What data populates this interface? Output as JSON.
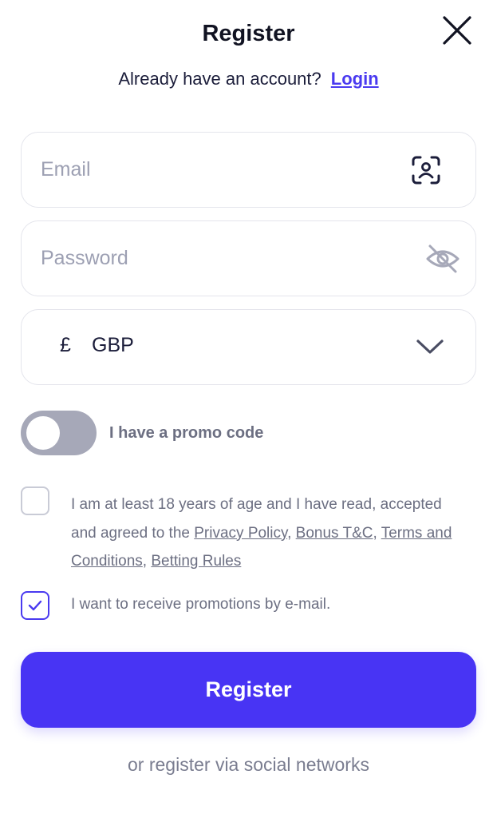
{
  "header": {
    "title": "Register",
    "already_text": "Already have an account?",
    "login_link": "Login"
  },
  "form": {
    "email": {
      "placeholder": "Email",
      "value": "",
      "icon": "face-id-icon"
    },
    "password": {
      "placeholder": "Password",
      "value": "",
      "icon": "eye-off-icon"
    },
    "currency": {
      "symbol": "£",
      "code": "GBP",
      "icon": "chevron-down-icon"
    }
  },
  "promo_toggle": {
    "label": "I have a promo code",
    "enabled": false
  },
  "terms": {
    "checked": false,
    "text_before": "I am at least 18 years of age and I have read, accepted and agreed to the ",
    "links": [
      "Privacy Policy",
      "Bonus T&C",
      "Terms and Conditions",
      "Betting Rules"
    ],
    "separator": ", "
  },
  "promotions": {
    "checked": true,
    "label": "I want to receive promotions by e-mail."
  },
  "submit": {
    "label": "Register"
  },
  "social": {
    "text": "or register via social networks"
  },
  "colors": {
    "accent": "#4834f4",
    "link": "#4a3af0",
    "muted_text": "#6c6f82",
    "border": "#e4e5ec"
  }
}
